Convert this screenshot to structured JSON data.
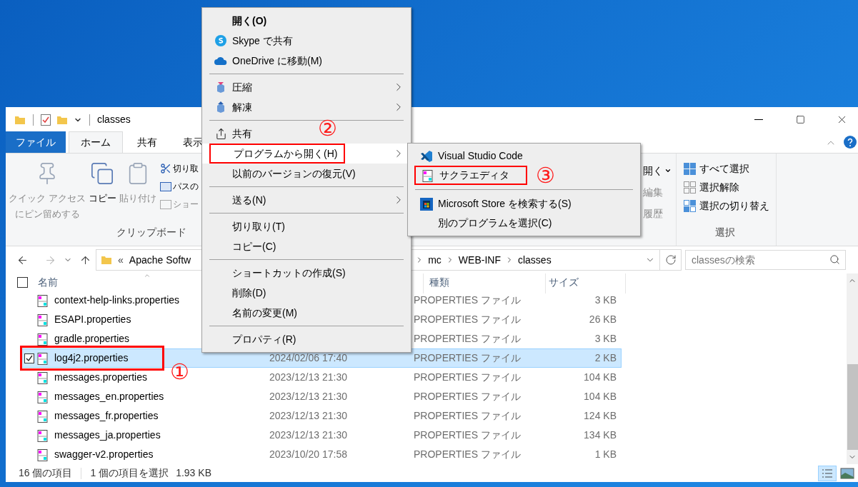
{
  "window": {
    "title": "classes"
  },
  "ribbon": {
    "tabs": [
      {
        "label": "ファイル",
        "kind": "file",
        "selected": false
      },
      {
        "label": "ホーム",
        "kind": "tab",
        "selected": true
      },
      {
        "label": "共有",
        "kind": "tab",
        "selected": false
      },
      {
        "label": "表示",
        "kind": "tab",
        "selected": false
      }
    ],
    "clipboard": {
      "large": [
        {
          "lines": [
            "クイック アクセス",
            "にピン留めする"
          ],
          "disabled": true
        },
        {
          "lines": [
            "コピー"
          ],
          "disabled": false
        },
        {
          "lines": [
            "貼り付け"
          ],
          "disabled": true
        }
      ],
      "small": [
        {
          "label": "切り取",
          "disabled": false
        },
        {
          "label": "パスの",
          "disabled": false
        },
        {
          "label": "ショー",
          "disabled": true
        }
      ],
      "label": "クリップボード"
    },
    "open": {
      "items": [
        {
          "label": "開く",
          "caret": true,
          "disabled": false
        },
        {
          "label": "編集",
          "caret": false,
          "disabled": true
        },
        {
          "label": "履歴",
          "caret": false,
          "disabled": true
        }
      ]
    },
    "select": {
      "items": [
        "すべて選択",
        "選択解除",
        "選択の切り替え"
      ],
      "label": "選択"
    }
  },
  "address": {
    "overflow": "«",
    "left": "Apache Softw",
    "right": [
      "mc",
      "WEB-INF",
      "classes"
    ],
    "search_placeholder": "classesの検索"
  },
  "columns": [
    "名前",
    "種類",
    "サイズ"
  ],
  "select_all": {
    "checked": false
  },
  "files": [
    {
      "name": "context-help-links.properties",
      "type": "PROPERTIES ファイル",
      "size": "3 KB",
      "selected": false,
      "checked": false
    },
    {
      "name": "ESAPI.properties",
      "type": "PROPERTIES ファイル",
      "size": "26 KB",
      "selected": false,
      "checked": false
    },
    {
      "name": "gradle.properties",
      "type": "PROPERTIES ファイル",
      "size": "3 KB",
      "selected": false,
      "checked": false
    },
    {
      "name": "log4j2.properties",
      "date": "2024/02/06 17:40",
      "type": "PROPERTIES ファイル",
      "size": "2 KB",
      "selected": true,
      "checked": true,
      "marked": true,
      "callout": "①"
    },
    {
      "name": "messages.properties",
      "date": "2023/12/13 21:30",
      "type": "PROPERTIES ファイル",
      "size": "104 KB",
      "selected": false,
      "checked": false
    },
    {
      "name": "messages_en.properties",
      "date": "2023/12/13 21:30",
      "type": "PROPERTIES ファイル",
      "size": "104 KB",
      "selected": false,
      "checked": false
    },
    {
      "name": "messages_fr.properties",
      "date": "2023/12/13 21:30",
      "type": "PROPERTIES ファイル",
      "size": "124 KB",
      "selected": false,
      "checked": false
    },
    {
      "name": "messages_ja.properties",
      "date": "2023/12/13 21:30",
      "type": "PROPERTIES ファイル",
      "size": "134 KB",
      "selected": false,
      "checked": false
    },
    {
      "name": "swagger-v2.properties",
      "date": "2023/10/20 17:58",
      "type": "PROPERTIES ファイル",
      "size": "1 KB",
      "selected": false,
      "checked": false
    }
  ],
  "status_bar": {
    "count": "16 個の項目",
    "selection": "1 個の項目を選択",
    "size": "1.93 KB"
  },
  "context_menu": [
    {
      "kind": "item",
      "label": "開く(O)",
      "default": true,
      "submenu": false,
      "selected": false
    },
    {
      "kind": "item",
      "label": "Skype で共有",
      "default": false,
      "submenu": false,
      "selected": false
    },
    {
      "kind": "item",
      "label": "OneDrive に移動(M)",
      "default": false,
      "submenu": false,
      "selected": false
    },
    {
      "kind": "separator"
    },
    {
      "kind": "item",
      "label": "圧縮",
      "default": false,
      "submenu": true,
      "selected": false
    },
    {
      "kind": "item",
      "label": "解凍",
      "default": false,
      "submenu": true,
      "selected": false
    },
    {
      "kind": "separator"
    },
    {
      "kind": "item",
      "label": "共有",
      "default": false,
      "submenu": false,
      "selected": false
    },
    {
      "kind": "item",
      "label": "プログラムから開く(H)",
      "default": false,
      "submenu": true,
      "selected": true,
      "marked": true,
      "callout": "②"
    },
    {
      "kind": "item",
      "label": "以前のバージョンの復元(V)",
      "default": false,
      "submenu": false,
      "selected": false
    },
    {
      "kind": "separator"
    },
    {
      "kind": "item",
      "label": "送る(N)",
      "default": false,
      "submenu": true,
      "selected": false
    },
    {
      "kind": "separator"
    },
    {
      "kind": "item",
      "label": "切り取り(T)",
      "default": false,
      "submenu": false,
      "selected": false
    },
    {
      "kind": "item",
      "label": "コピー(C)",
      "default": false,
      "submenu": false,
      "selected": false
    },
    {
      "kind": "separator"
    },
    {
      "kind": "item",
      "label": "ショートカットの作成(S)",
      "default": false,
      "submenu": false,
      "selected": false
    },
    {
      "kind": "item",
      "label": "削除(D)",
      "default": false,
      "submenu": false,
      "selected": false
    },
    {
      "kind": "item",
      "label": "名前の変更(M)",
      "default": false,
      "submenu": false,
      "selected": false
    },
    {
      "kind": "separator"
    },
    {
      "kind": "item",
      "label": "プロパティ(R)",
      "default": false,
      "submenu": false,
      "selected": false
    }
  ],
  "open_with_menu": [
    {
      "kind": "item",
      "label": "Visual Studio Code"
    },
    {
      "kind": "item",
      "label": "サクラエディタ",
      "marked": true,
      "callout": "③"
    },
    {
      "kind": "separator"
    },
    {
      "kind": "item",
      "label": "Microsoft Store を検索する(S)"
    },
    {
      "kind": "item",
      "label": "別のプログラムを選択(C)"
    }
  ]
}
